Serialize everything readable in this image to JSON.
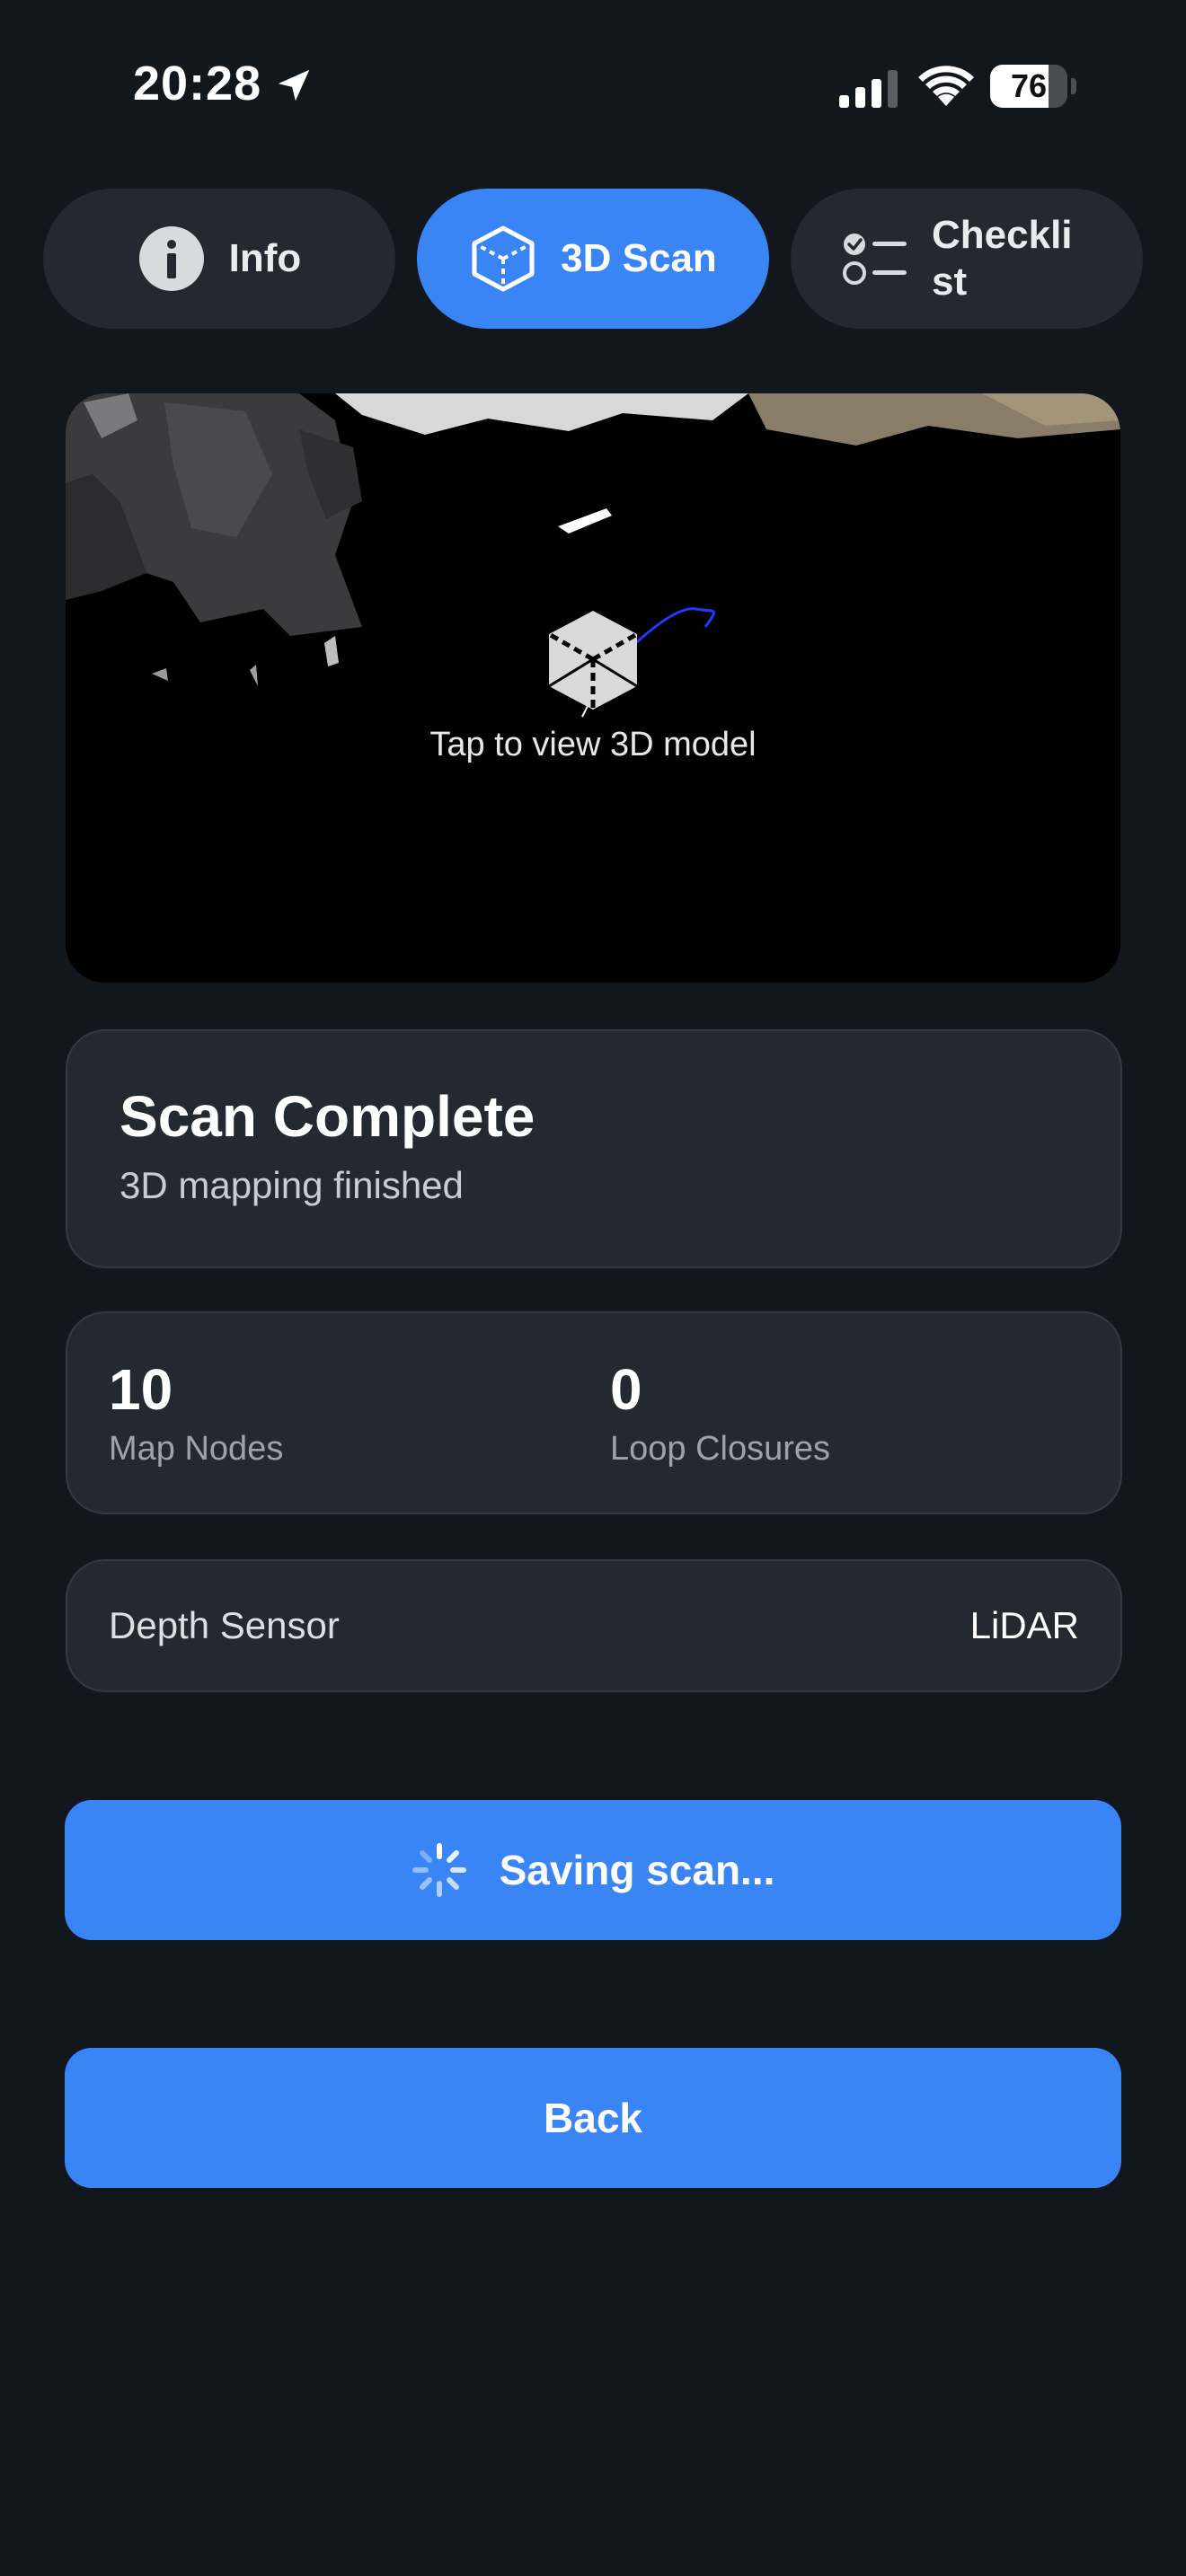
{
  "status_bar": {
    "time": "20:28",
    "battery_level": 76,
    "battery_text": "76",
    "icons": [
      "location-arrow-icon",
      "cellular-signal-icon",
      "wifi-icon",
      "battery-icon"
    ]
  },
  "tabs": [
    {
      "label": "Info",
      "icon": "info-icon",
      "active": false
    },
    {
      "label": "3D Scan",
      "icon": "cube-icon",
      "active": true
    },
    {
      "label": "Checklist",
      "icon": "checklist-icon",
      "active": false
    }
  ],
  "viewer": {
    "caption": "Tap to view 3D model",
    "icon": "cube-icon"
  },
  "scan_status": {
    "title": "Scan Complete",
    "subtitle": "3D mapping finished"
  },
  "stats": {
    "map_nodes": {
      "value": "10",
      "label": "Map Nodes"
    },
    "loop_closures": {
      "value": "0",
      "label": "Loop Closures"
    }
  },
  "sensor": {
    "label": "Depth Sensor",
    "value": "LiDAR"
  },
  "buttons": {
    "save_label": "Saving scan...",
    "back_label": "Back"
  },
  "colors": {
    "background": "#12161d",
    "card": "#242830",
    "accent": "#3a85f6",
    "tab_inactive": "#242830"
  }
}
